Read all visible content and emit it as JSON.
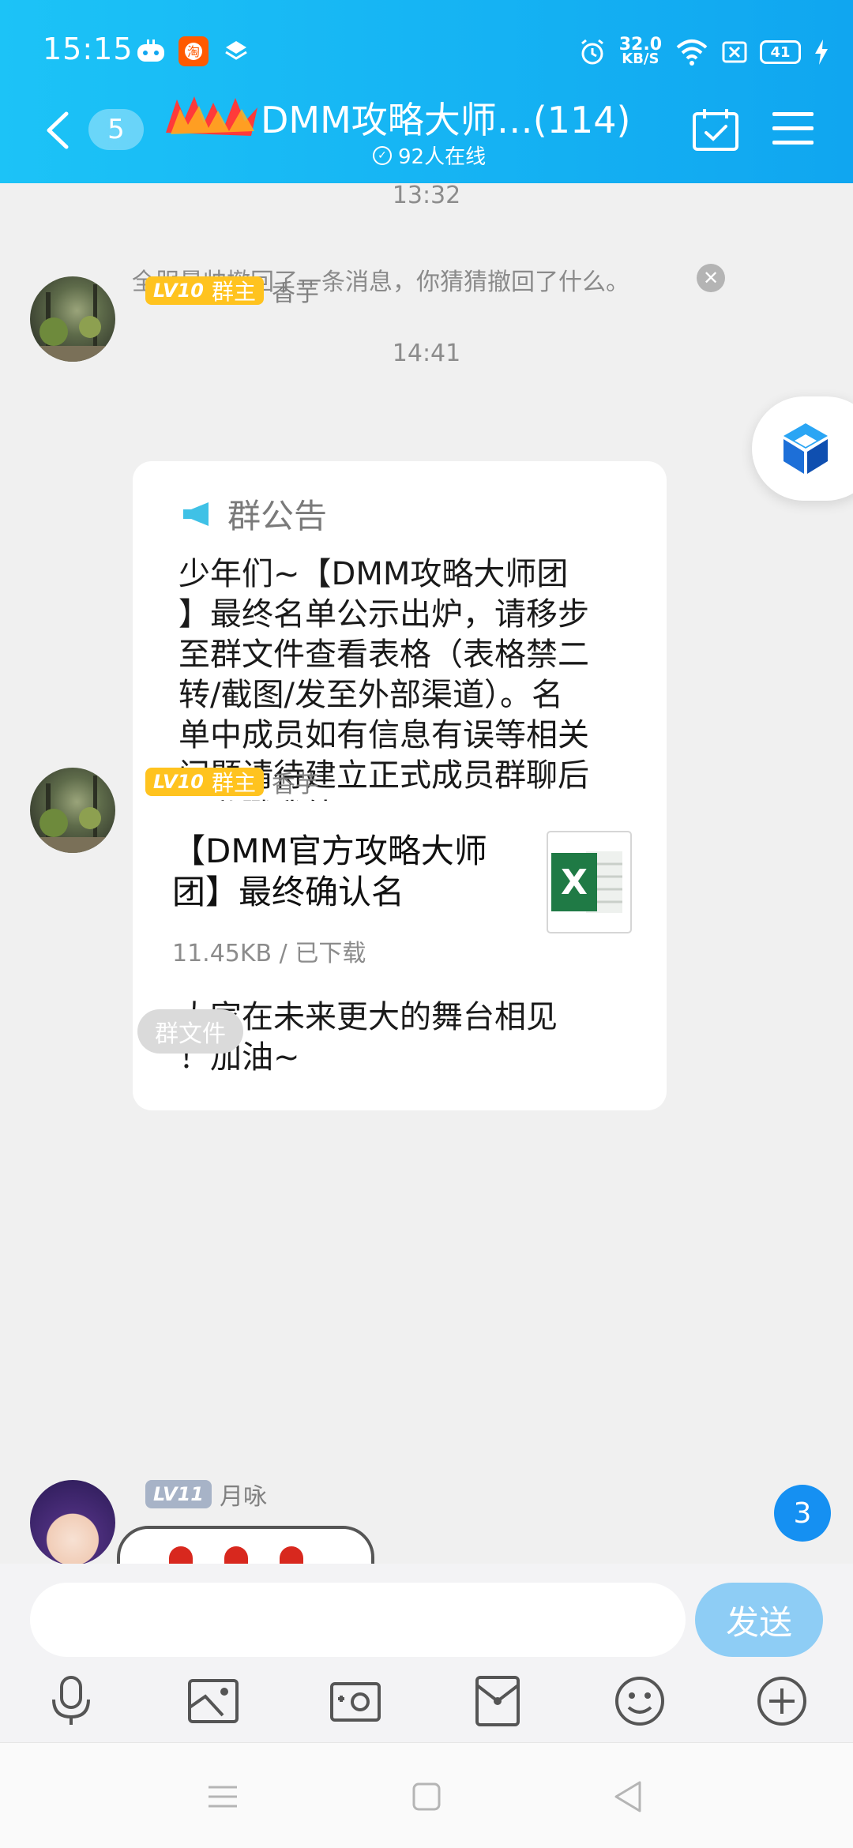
{
  "status_bar": {
    "time": "15:15",
    "net_speed_value": "32.0",
    "net_speed_unit": "KB/S",
    "battery": "41"
  },
  "header": {
    "unread_count": "5",
    "title": "DMM攻略大师…(114)",
    "online": "92人在线"
  },
  "chat": {
    "time_1": "13:32",
    "recall_notice": "全服最帅撤回了一条消息，你猜猜撤回了什么。",
    "time_2": "14:41",
    "messages": [
      {
        "level": "LV10",
        "role": "群主",
        "sender": "香芋",
        "type": "announcement",
        "announcement_title": "群公告",
        "body": "少年们~【DMM攻略大师团\n】最终名单公示出炉，请移步\n至群文件查看表格（表格禁二\n转/截图/发至外部渠道）。名\n单中成员如有信息有误等相关\n问题请待建立正式成员群聊后\n，私戳我处理。\n所有按照规定完成考核任务的\n玩家，请于今天查收邮箱内奖\n励~\n未通过选拔也不要灰心哦！愿\n大家在未来更大的舞台相见\n！加油~"
      },
      {
        "level": "LV10",
        "role": "群主",
        "sender": "香芋",
        "type": "file",
        "file_name": "【DMM官方攻略大师团】最终确认名",
        "file_meta": "11.45KB / 已下载",
        "file_tag": "群文件"
      },
      {
        "level": "LV11",
        "role": "",
        "sender": "月咏",
        "type": "sticker"
      }
    ],
    "new_message_count": "3"
  },
  "input": {
    "placeholder": "",
    "send_label": "发送",
    "toolbar": [
      "microphone-icon",
      "image-icon",
      "camera-icon",
      "red-packet-icon",
      "emoji-icon",
      "plus-icon"
    ]
  },
  "nav": [
    "menu-icon",
    "home-icon",
    "back-icon"
  ],
  "colors": {
    "header_start": "#1cc3f7",
    "header_end": "#10a6f0",
    "level_badge": "#ffc31f",
    "level_badge_gray": "#a7b3c7",
    "send_button": "#8ecdf5",
    "unread_bubble": "#1590f2",
    "excel_green": "#1f7a45"
  }
}
